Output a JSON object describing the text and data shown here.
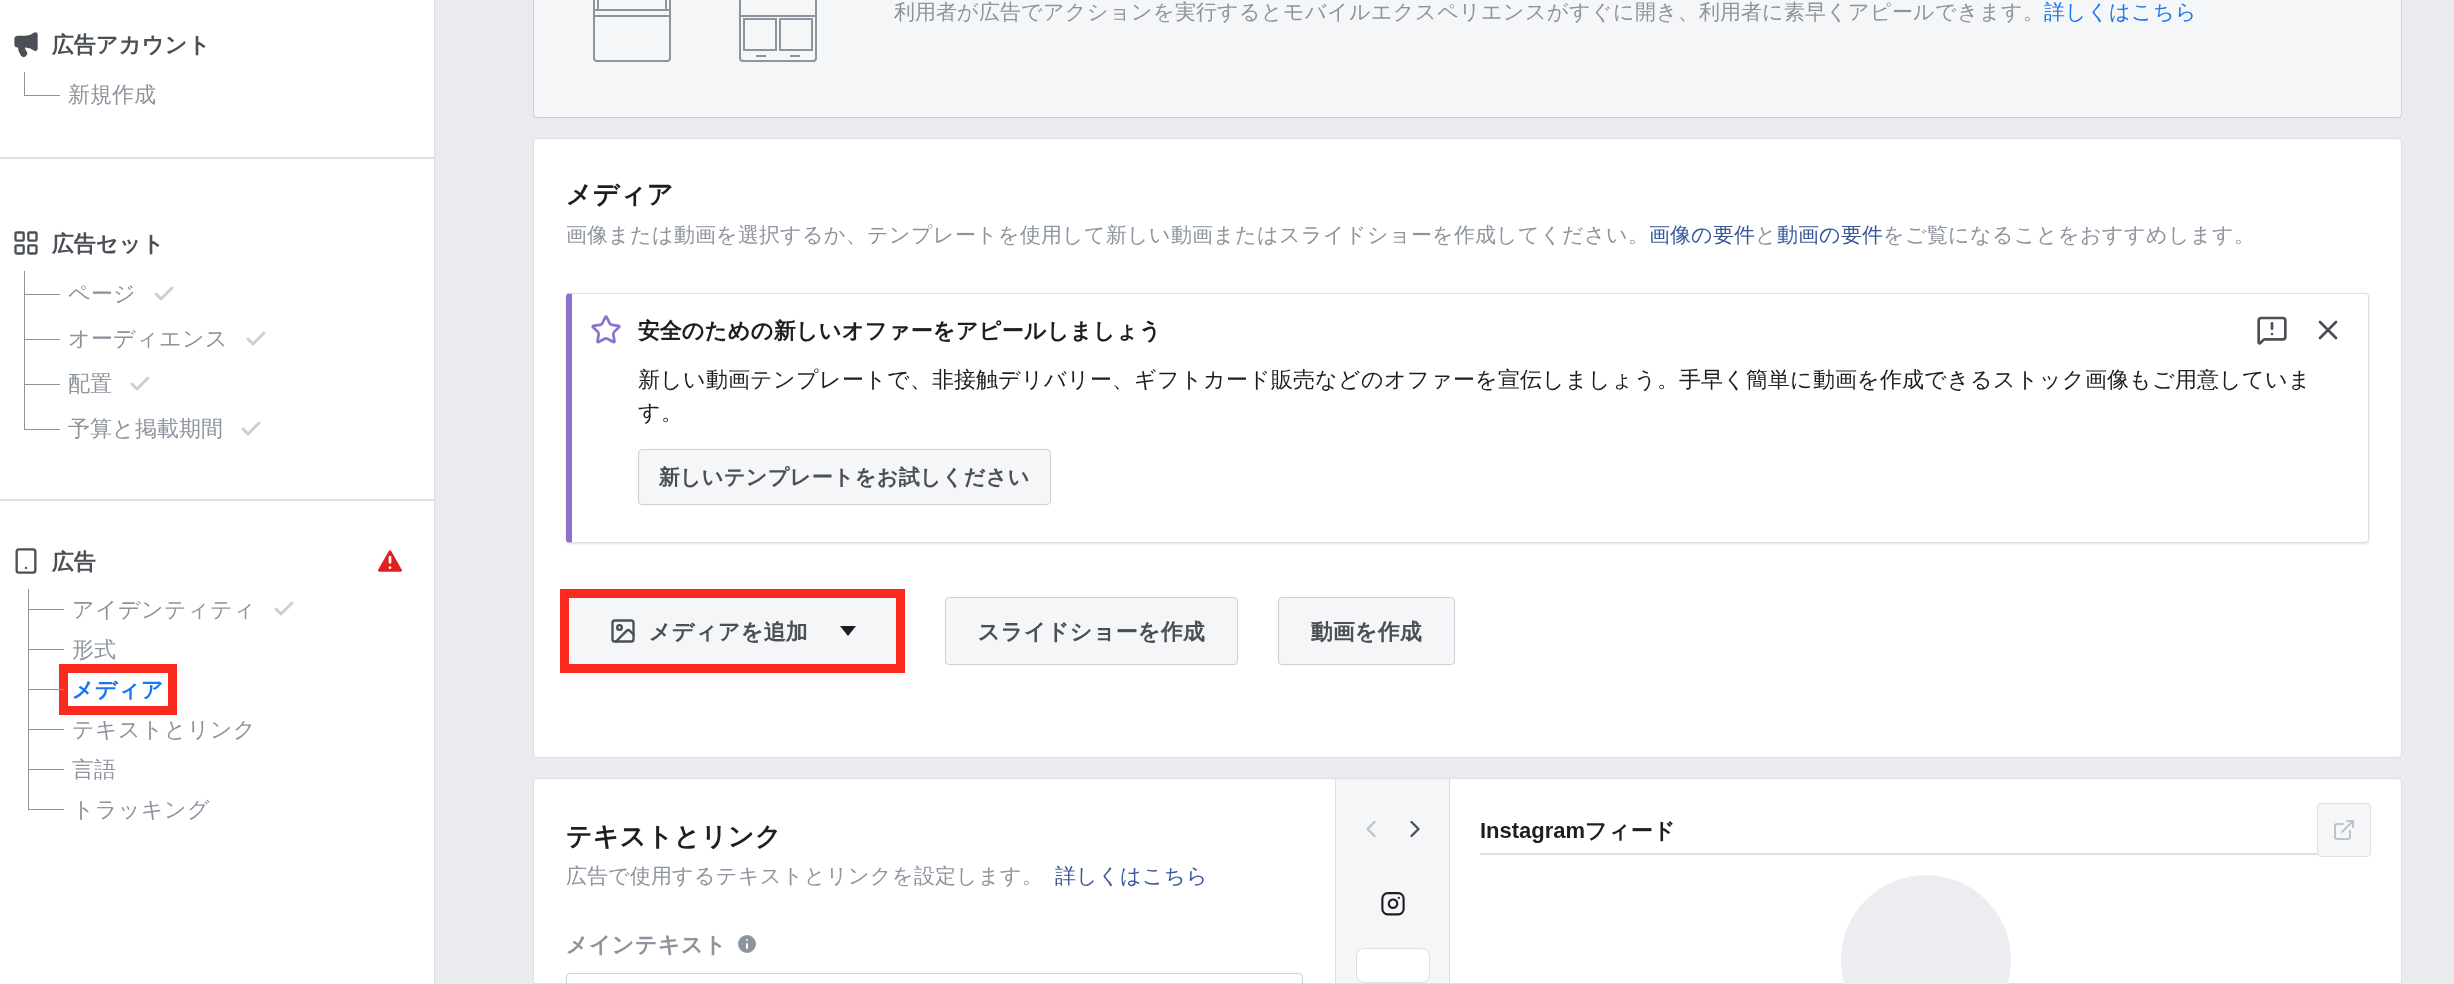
{
  "sidebar": {
    "sections": [
      {
        "kind": "account",
        "title": "広告アカウント",
        "warning": false,
        "items": [
          {
            "label": "新規作成",
            "done": false,
            "selected": false,
            "highlighted": false
          }
        ]
      },
      {
        "kind": "adset",
        "title": "広告セット",
        "warning": false,
        "items": [
          {
            "label": "ページ",
            "done": true,
            "selected": false,
            "highlighted": false
          },
          {
            "label": "オーディエンス",
            "done": true,
            "selected": false,
            "highlighted": false
          },
          {
            "label": "配置",
            "done": true,
            "selected": false,
            "highlighted": false
          },
          {
            "label": "予算と掲載期間",
            "done": true,
            "selected": false,
            "highlighted": false
          }
        ]
      },
      {
        "kind": "ad",
        "title": "広告",
        "warning": true,
        "items": [
          {
            "label": "アイデンティティ",
            "done": true,
            "selected": false,
            "highlighted": false
          },
          {
            "label": "形式",
            "done": false,
            "selected": false,
            "highlighted": false
          },
          {
            "label": "メディア",
            "done": false,
            "selected": true,
            "highlighted": true
          },
          {
            "label": "テキストとリンク",
            "done": false,
            "selected": false,
            "highlighted": false
          },
          {
            "label": "言語",
            "done": false,
            "selected": false,
            "highlighted": false
          },
          {
            "label": "トラッキング",
            "done": false,
            "selected": false,
            "highlighted": false
          }
        ]
      }
    ]
  },
  "format_card": {
    "description": "利用者が広告でアクションを実行するとモバイルエクスペリエンスがすぐに開き、利用者に素早くアピールできます。",
    "link": "詳しくはこちら"
  },
  "media_card": {
    "title": "メディア",
    "description": [
      {
        "kind": "text",
        "text": "画像または動画を選択するか、テンプレートを使用して新しい動画またはスライドショーを作成してください。"
      },
      {
        "kind": "link",
        "text": "画像の要件"
      },
      {
        "kind": "text",
        "text": "と"
      },
      {
        "kind": "link",
        "text": "動画の要件"
      },
      {
        "kind": "text",
        "text": "をご覧になることをおすすめします。"
      }
    ],
    "notice": {
      "title": "安全のための新しいオファーをアピールしましょう",
      "body": "新しい動画テンプレートで、非接触デリバリー、ギフトカード販売などのオファーを宣伝しましょう。手早く簡単に動画を作成できるストック画像もご用意しています。",
      "button": "新しいテンプレートをお試しください"
    },
    "buttons": [
      {
        "kind": "dropdown",
        "label": "メディアを追加",
        "highlighted": true
      },
      {
        "kind": "plain",
        "label": "スライドショーを作成",
        "highlighted": false
      },
      {
        "kind": "plain",
        "label": "動画を作成",
        "highlighted": false
      }
    ]
  },
  "text_card": {
    "title": "テキストとリンク",
    "description": "広告で使用するテキストとリンクを設定します。",
    "link": "詳しくはこちら",
    "field_label": "メインテキスト"
  },
  "preview": {
    "title": "Instagramフィード"
  }
}
